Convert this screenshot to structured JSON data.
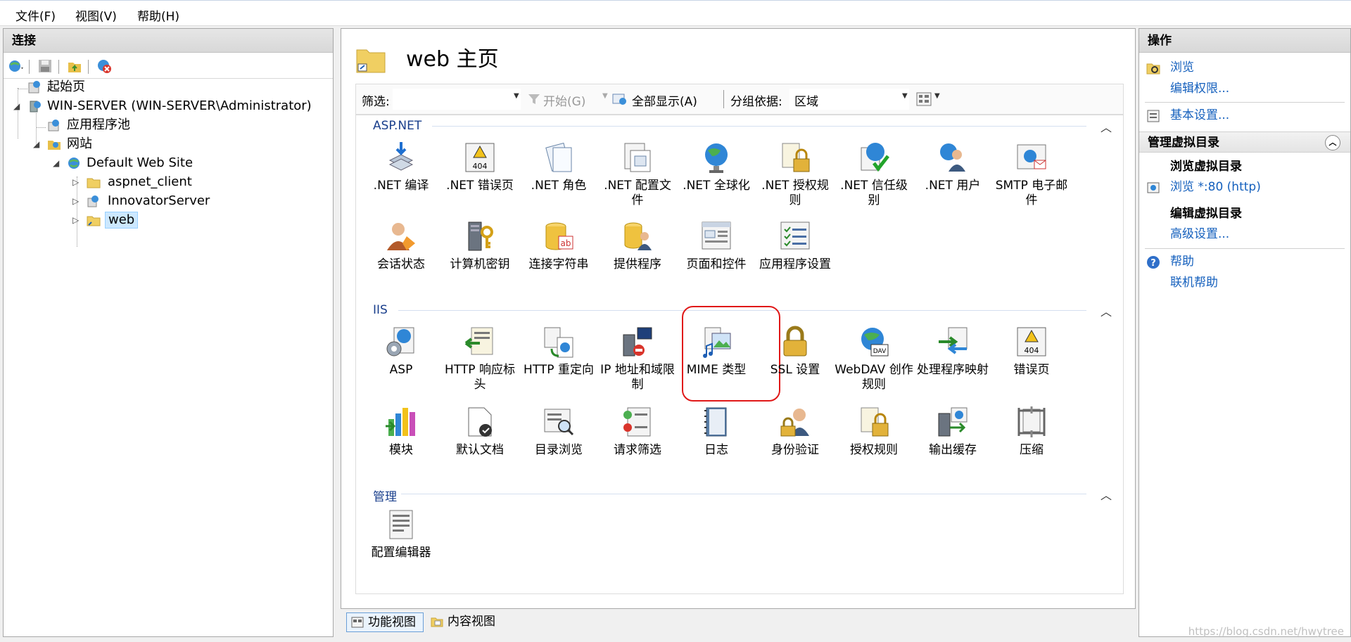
{
  "menubar": {
    "items": [
      "文件(F)",
      "视图(V)",
      "帮助(H)"
    ]
  },
  "left": {
    "title": "连接",
    "tree": [
      {
        "label": "起始页"
      },
      {
        "label": "WIN-SERVER (WIN-SERVER\\Administrator)"
      },
      {
        "label": "应用程序池"
      },
      {
        "label": "网站"
      },
      {
        "label": "Default Web Site"
      },
      {
        "label": "aspnet_client"
      },
      {
        "label": "InnovatorServer"
      },
      {
        "label": "web"
      }
    ]
  },
  "center": {
    "title": "web 主页",
    "filter": {
      "label": "筛选:",
      "start": "开始(G)",
      "show_all": "全部显示(A)",
      "group_by": "分组依据:",
      "group_value": "区域"
    },
    "groups": [
      {
        "title": "ASP.NET",
        "items": [
          ".NET 编译",
          ".NET 错误页",
          ".NET 角色",
          ".NET 配置文件",
          ".NET 全球化",
          ".NET 授权规则",
          ".NET 信任级别",
          ".NET 用户",
          "SMTP 电子邮件",
          "会话状态",
          "计算机密钥",
          "连接字符串",
          "提供程序",
          "页面和控件",
          "应用程序设置"
        ]
      },
      {
        "title": "IIS",
        "items": [
          "ASP",
          "HTTP 响应标头",
          "HTTP 重定向",
          "IP 地址和域限制",
          "MIME 类型",
          "SSL 设置",
          "WebDAV 创作规则",
          "处理程序映射",
          "错误页",
          "模块",
          "默认文档",
          "目录浏览",
          "请求筛选",
          "日志",
          "身份验证",
          "授权规则",
          "输出缓存",
          "压缩"
        ]
      },
      {
        "title": "管理",
        "items": [
          "配置编辑器"
        ]
      }
    ]
  },
  "bottom_tabs": [
    "功能视图",
    "内容视图"
  ],
  "right": {
    "title": "操作",
    "browse": "浏览",
    "edit_permissions": "编辑权限...",
    "basic_settings": "基本设置...",
    "section_vdir": "管理虚拟目录",
    "browse_vdir": "浏览虚拟目录",
    "browse_port": "浏览 *:80 (http)",
    "edit_vdir": "编辑虚拟目录",
    "advanced_settings": "高级设置...",
    "help": "帮助",
    "online_help": "联机帮助"
  },
  "watermark": "https://blog.csdn.net/hwytree",
  "colors": {
    "link": "#1560bd",
    "group_title": "#1a3f8c",
    "highlight": "#e01818"
  }
}
